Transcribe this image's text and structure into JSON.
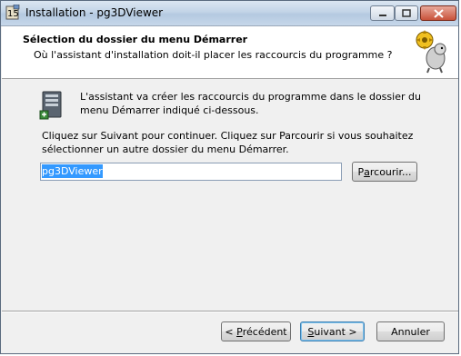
{
  "window": {
    "title": "Installation - pg3DViewer",
    "icons": {
      "app": "installer-icon",
      "minimize": "minimize-icon",
      "maximize": "maximize-icon",
      "close": "close-icon"
    }
  },
  "header": {
    "title": "Sélection du dossier du menu Démarrer",
    "subtitle": "Où l'assistant d'installation doit-il placer les raccourcis du programme ?",
    "logo_icon": "wizard-mascot-icon"
  },
  "body": {
    "icon": "start-menu-folder-icon",
    "description": "L'assistant va créer les raccourcis du programme dans le dossier du menu Démarrer indiqué ci-dessous.",
    "instructions": "Cliquez sur Suivant pour continuer. Cliquez sur Parcourir si vous souhaitez sélectionner un autre dossier du menu Démarrer.",
    "folder_value": "pg3DViewer",
    "browse_label": "Parcourir...",
    "browse_underline": "a",
    "browse_pre": "P",
    "browse_post": "rcourir..."
  },
  "footer": {
    "prev": {
      "pre": "< ",
      "u": "P",
      "post": "récédent"
    },
    "next": {
      "pre": "",
      "u": "S",
      "post": "uivant >"
    },
    "cancel_label": "Annuler"
  },
  "colors": {
    "selection": "#3399ff",
    "titlebar": "#c2d4e7",
    "close": "#c8523a"
  }
}
